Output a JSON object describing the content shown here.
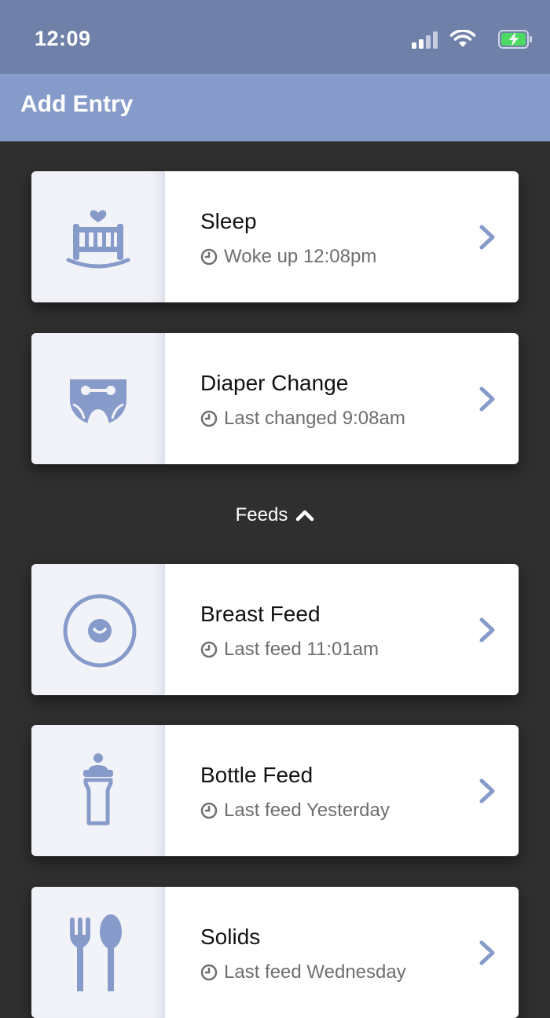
{
  "status_bar": {
    "time": "12:09",
    "icons": [
      "signal-icon",
      "wifi-icon",
      "battery-charging-icon"
    ]
  },
  "header": {
    "title": "Add Entry"
  },
  "colors": {
    "accent": "#879bca",
    "status_bar": "#6f80a9",
    "background": "#2f2f30",
    "card": "#ffffff",
    "icon_panel": "#f2f3f8"
  },
  "entries": [
    {
      "title": "Sleep",
      "subtitle": "Woke up 12:08pm",
      "icon": "crib-icon"
    },
    {
      "title": "Diaper Change",
      "subtitle": "Last changed 9:08am",
      "icon": "diaper-icon"
    }
  ],
  "feeds_section": {
    "label": "Feeds",
    "expanded": true,
    "entries": [
      {
        "title": "Breast Feed",
        "subtitle": "Last feed 11:01am",
        "icon": "breast-icon"
      },
      {
        "title": "Bottle Feed",
        "subtitle": "Last feed Yesterday",
        "icon": "bottle-icon"
      },
      {
        "title": "Solids",
        "subtitle": "Last feed Wednesday",
        "icon": "fork-spoon-icon"
      }
    ]
  }
}
